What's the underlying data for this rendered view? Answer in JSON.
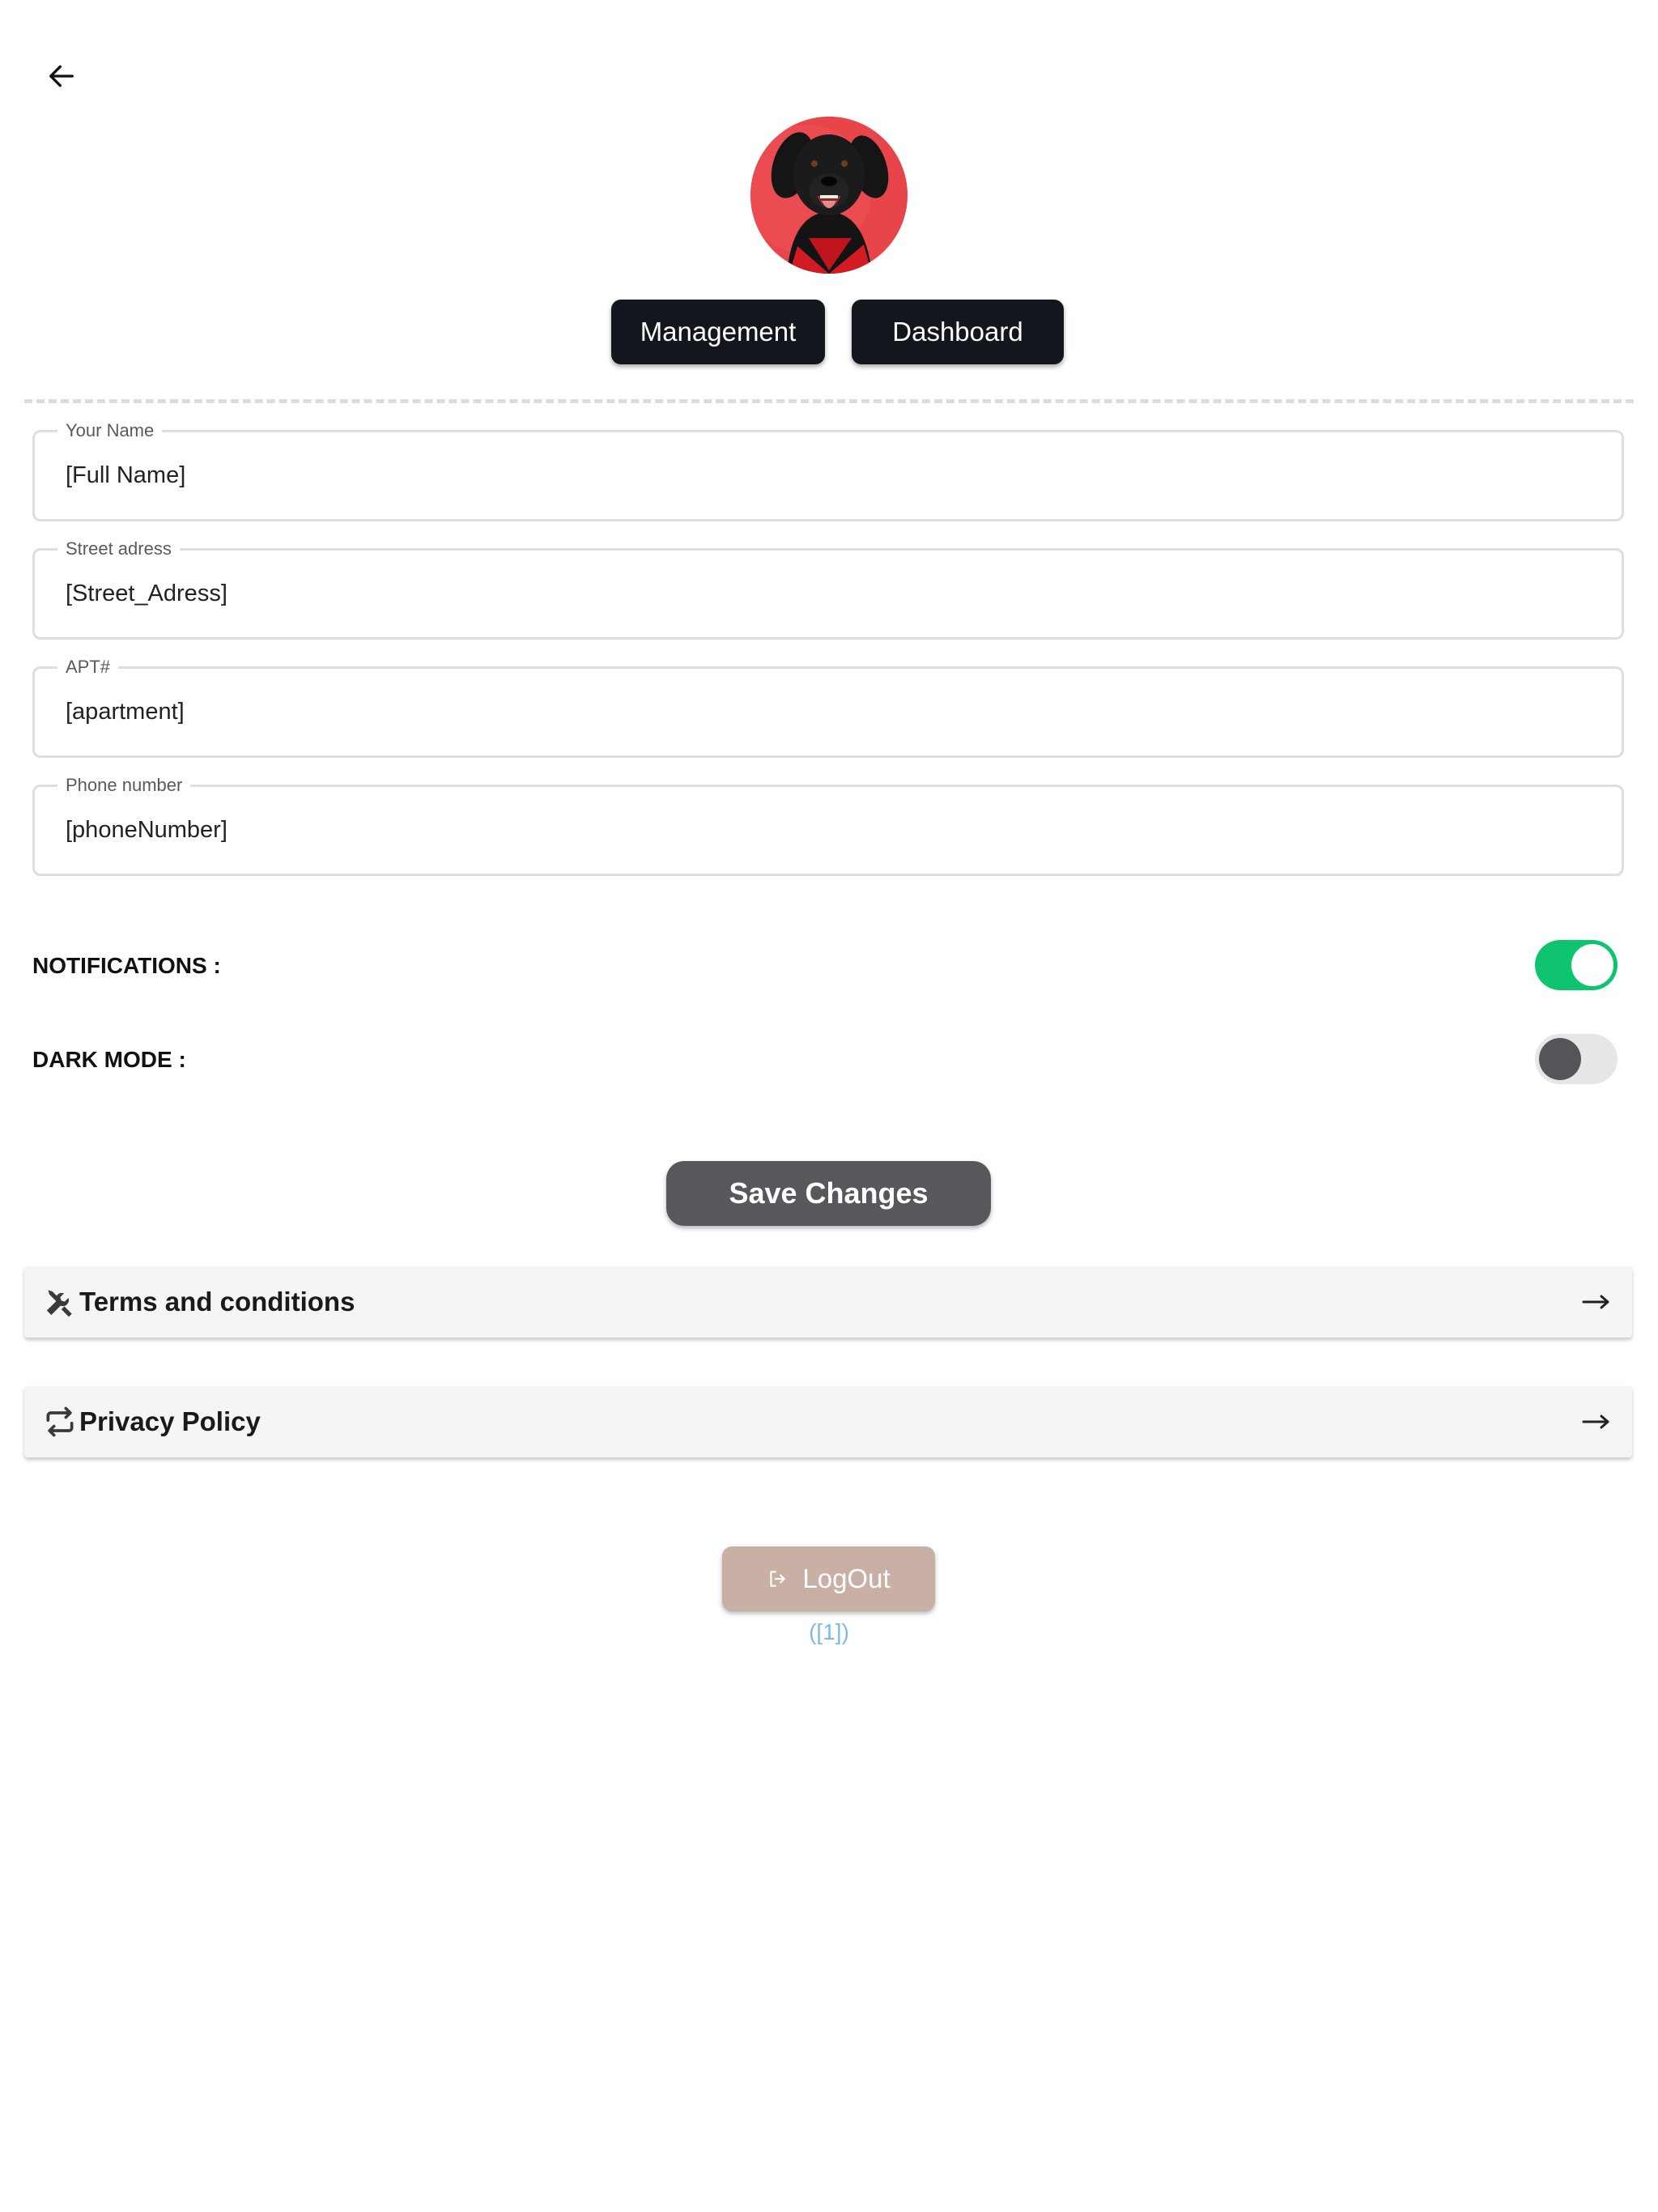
{
  "header": {
    "back_icon": "arrow-left-icon"
  },
  "profile": {
    "avatar_description": "dog-avatar"
  },
  "nav": {
    "management_label": "Management",
    "dashboard_label": "Dashboard"
  },
  "form": {
    "name": {
      "label": "Your Name",
      "value": "[Full Name]"
    },
    "street": {
      "label": "Street adress",
      "value": "[Street_Adress]"
    },
    "apt": {
      "label": "APT#",
      "value": "[apartment]"
    },
    "phone": {
      "label": "Phone number",
      "value": "[phoneNumber]"
    }
  },
  "settings": {
    "notifications": {
      "label": "NOTIFICATIONS :",
      "enabled": true
    },
    "dark_mode": {
      "label": "DARK MODE :",
      "enabled": false
    }
  },
  "actions": {
    "save_label": "Save Changes"
  },
  "links": {
    "terms": {
      "label": "Terms and conditions",
      "icon": "tools-icon"
    },
    "privacy": {
      "label": "Privacy Policy",
      "icon": "repeat-icon"
    }
  },
  "logout": {
    "label": "LogOut",
    "icon": "logout-icon"
  },
  "footer": {
    "version": "([1])"
  },
  "colors": {
    "toggle_on": "#0ec46f",
    "nav_button": "#13161c",
    "save_button": "#57585c",
    "logout_button": "#c9b0a4",
    "version_text": "#7fb8e6"
  }
}
